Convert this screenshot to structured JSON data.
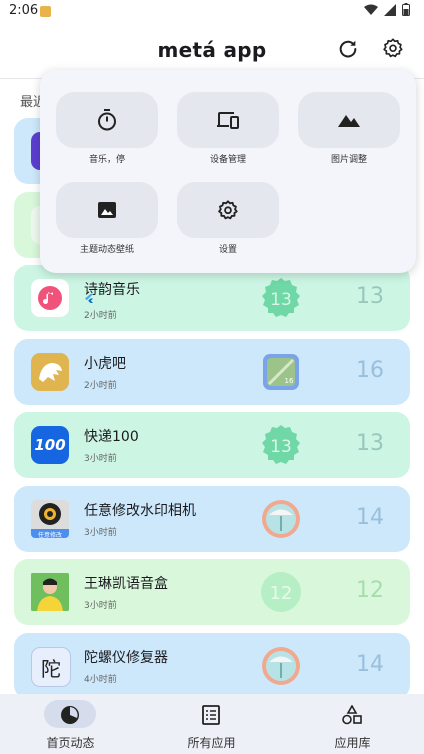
{
  "status_bar": {
    "time": "2:06"
  },
  "app_bar": {
    "title": "metá app"
  },
  "section": {
    "recent_label": "最近"
  },
  "quick_panel": {
    "items": [
      {
        "label": "音乐，停",
        "icon": "timer-icon"
      },
      {
        "label": "设备管理",
        "icon": "devices-icon"
      },
      {
        "label": "图片调整",
        "icon": "landscape-icon"
      },
      {
        "label": "主题动态壁纸",
        "icon": "image-icon"
      },
      {
        "label": "设置",
        "icon": "gear-icon"
      }
    ]
  },
  "apps": [
    {
      "name": "诗韵音乐",
      "time": "2小时前",
      "version": "13",
      "color": "mint"
    },
    {
      "name": "小虎吧",
      "time": "2小时前",
      "version": "16",
      "color": "blue"
    },
    {
      "name": "快递100",
      "time": "3小时前",
      "version": "13",
      "color": "mint"
    },
    {
      "name": "任意修改水印相机",
      "time": "3小时前",
      "version": "14",
      "color": "blue"
    },
    {
      "name": "王琳凯语音盒",
      "time": "3小时前",
      "version": "12",
      "color": "lime"
    },
    {
      "name": "陀螺仪修复器",
      "time": "4小时前",
      "version": "14",
      "color": "blue"
    }
  ],
  "app_icon_text": {
    "kuaidi": "100",
    "watermark": "任意修改",
    "tuoluo": "陀"
  },
  "bottom_nav": {
    "home": "首页动态",
    "all_apps": "所有应用",
    "library": "应用库"
  },
  "colors": {
    "badge_13": "#6fd8a6",
    "badge_14": "#f0a98f",
    "badge_12": "#b6efc6",
    "badge_16": "#7aa3e8"
  }
}
